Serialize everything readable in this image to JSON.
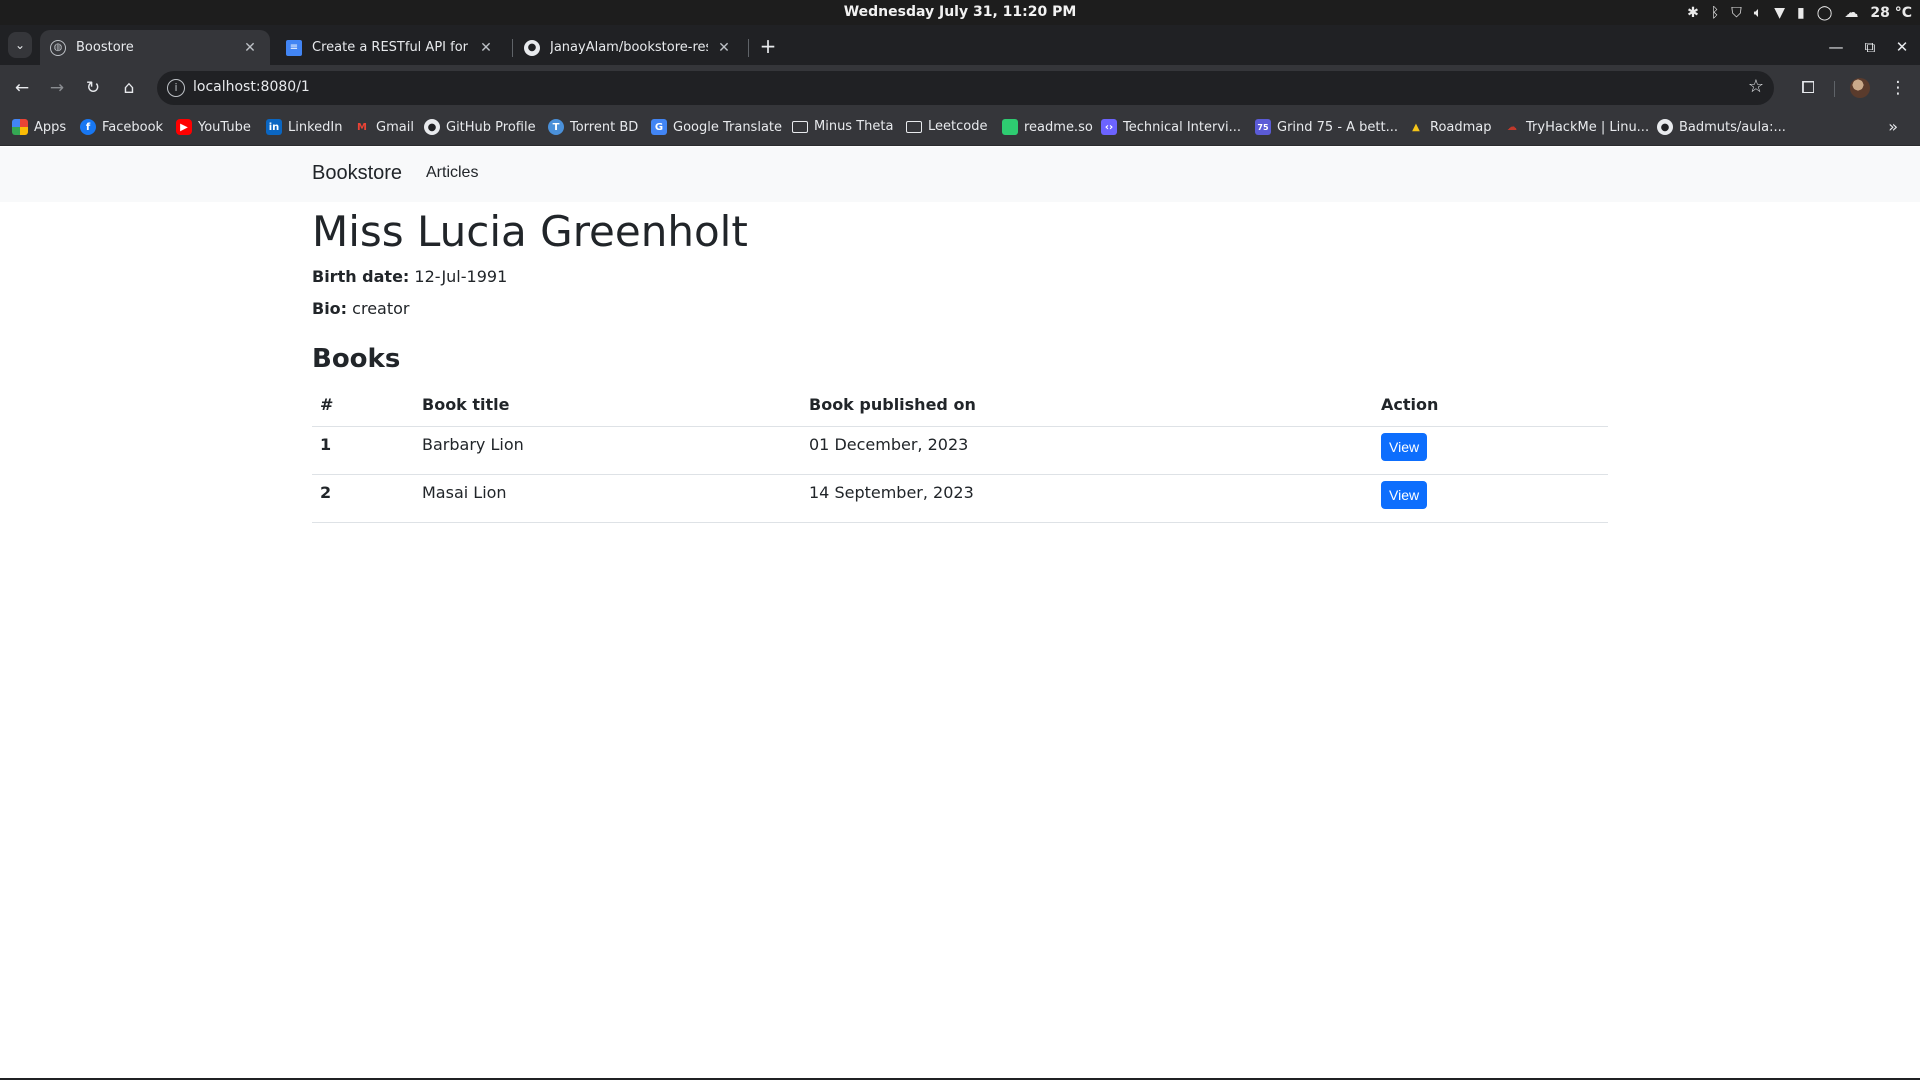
{
  "os": {
    "clock": "Wednesday July 31, 11:20 PM",
    "weather": "28 °C",
    "tray_icons": [
      "slack-icon",
      "bluetooth-icon",
      "shield-icon",
      "volume-icon",
      "wifi-icon",
      "battery-icon",
      "user-icon",
      "weather-icon"
    ]
  },
  "browser": {
    "tabs": [
      {
        "title": "Boostore",
        "icon": "globe-icon",
        "active": true
      },
      {
        "title": "Create a RESTful API for a Bo",
        "icon": "docs-icon",
        "active": false
      },
      {
        "title": "JanayAlam/bookstore-rest",
        "icon": "github-icon",
        "active": false
      }
    ],
    "url": "localhost:8080/1",
    "bookmarks": [
      {
        "label": "Apps",
        "icon": "apps-grid-icon",
        "color": "#e8453c"
      },
      {
        "label": "Facebook",
        "icon": "facebook-icon",
        "color": "#1877f2"
      },
      {
        "label": "YouTube",
        "icon": "youtube-icon",
        "color": "#ff0000"
      },
      {
        "label": "LinkedIn",
        "icon": "linkedin-icon",
        "color": "#0a66c2"
      },
      {
        "label": "Gmail",
        "icon": "gmail-icon",
        "color": "#ea4335"
      },
      {
        "label": "GitHub Profile",
        "icon": "github-icon",
        "color": "#ffffff"
      },
      {
        "label": "Torrent BD",
        "icon": "torrent-icon",
        "color": "#4a90d9"
      },
      {
        "label": "Google Translate",
        "icon": "translate-icon",
        "color": "#4285f4"
      },
      {
        "label": "Minus Theta",
        "icon": "folder-icon",
        "color": "#e8eaed"
      },
      {
        "label": "Leetcode",
        "icon": "folder-icon",
        "color": "#e8eaed"
      },
      {
        "label": "readme.so",
        "icon": "readme-icon",
        "color": "#2ecc71"
      },
      {
        "label": "Technical Intervi...",
        "icon": "code-icon",
        "color": "#6c63ff"
      },
      {
        "label": "Grind 75 - A bett...",
        "icon": "grind-icon",
        "color": "#5b5bd6"
      },
      {
        "label": "Roadmap",
        "icon": "roadmap-icon",
        "color": "#f5c518"
      },
      {
        "label": "TryHackMe | Linu...",
        "icon": "tryhackme-icon",
        "color": "#c0392b"
      },
      {
        "label": "Badmuts/aula:...",
        "icon": "github-icon",
        "color": "#ffffff"
      }
    ]
  },
  "page": {
    "brand": "Bookstore",
    "nav_articles": "Articles",
    "author": {
      "name": "Miss Lucia Greenholt",
      "birth_label": "Birth date:",
      "birth_date": "12-Jul-1991",
      "bio_label": "Bio:",
      "bio": "creator"
    },
    "books_heading": "Books",
    "table": {
      "headers": [
        "#",
        "Book title",
        "Book published on",
        "Action"
      ],
      "rows": [
        {
          "num": "1",
          "title": "Barbary Lion",
          "published": "01 December, 2023",
          "action": "View"
        },
        {
          "num": "2",
          "title": "Masai Lion",
          "published": "14 September, 2023",
          "action": "View"
        }
      ]
    }
  }
}
